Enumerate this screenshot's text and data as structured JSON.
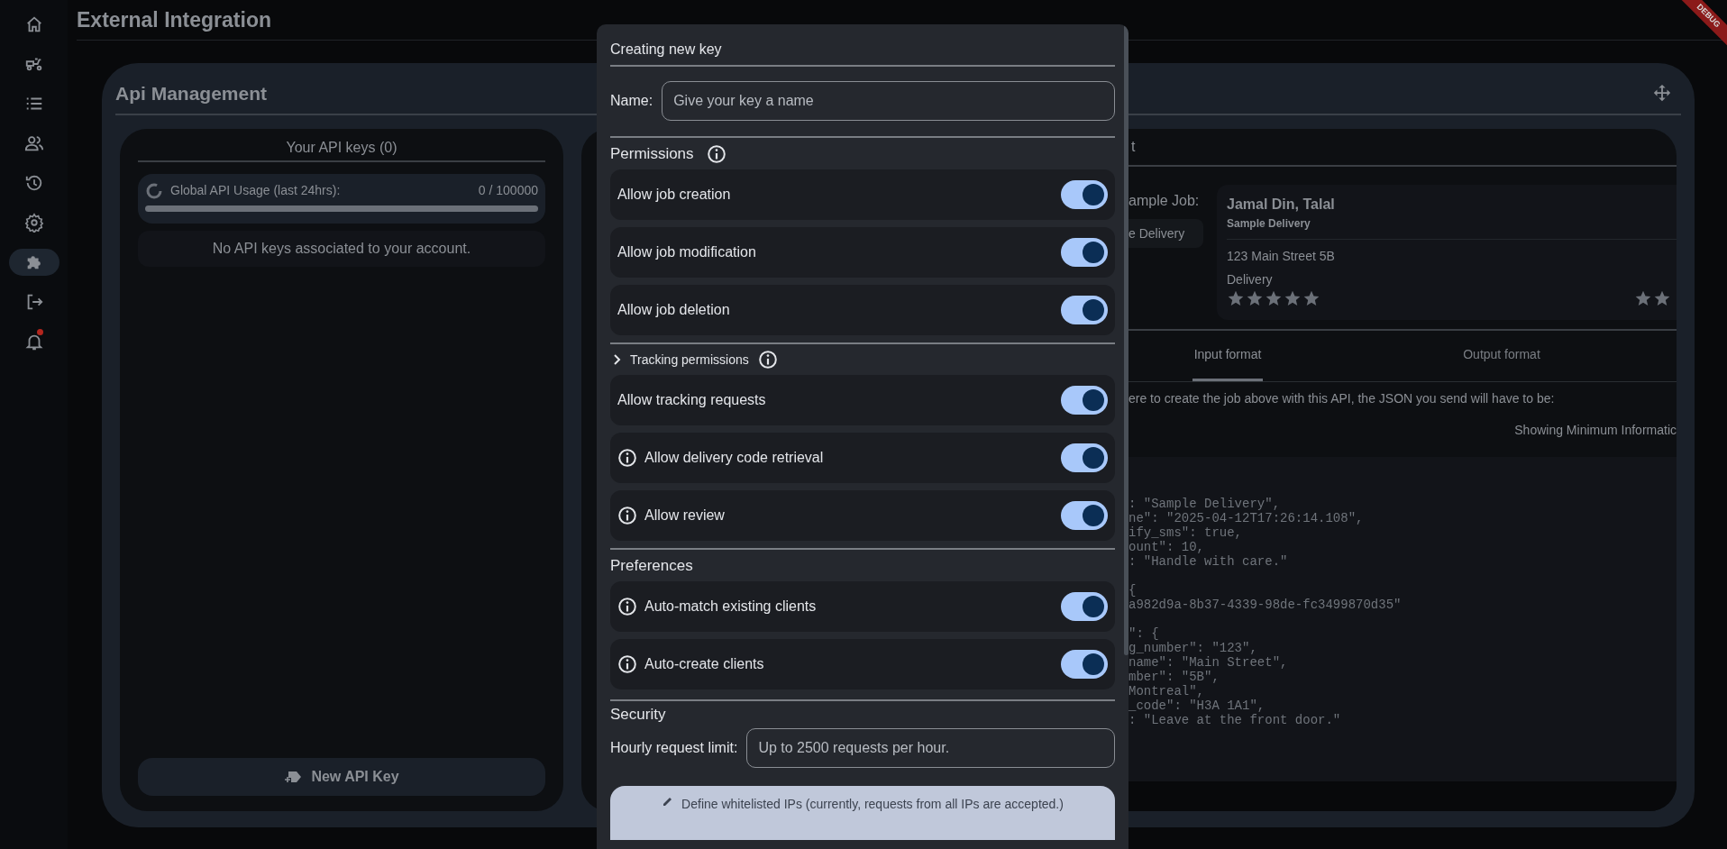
{
  "sidebar": {
    "items": [
      {
        "kind": "home",
        "selected": false,
        "notification": false
      },
      {
        "kind": "scooter",
        "selected": false,
        "notification": false
      },
      {
        "kind": "list",
        "selected": false,
        "notification": false
      },
      {
        "kind": "people",
        "selected": false,
        "notification": false
      },
      {
        "kind": "history",
        "selected": false,
        "notification": false
      },
      {
        "kind": "settings",
        "selected": false,
        "notification": false
      },
      {
        "kind": "puzzle",
        "selected": true,
        "notification": false
      },
      {
        "kind": "logout",
        "selected": false,
        "notification": false
      },
      {
        "kind": "bell",
        "selected": false,
        "notification": true
      }
    ]
  },
  "page_title": "External Integration",
  "debug_banner": "DEBUG",
  "api_management": {
    "title": "Api Management",
    "keys_panel": {
      "title": "Your API keys (0)",
      "usage": {
        "label": "Global API Usage (last 24hrs):",
        "value": "0 / 100000",
        "level": 0
      },
      "empty_message": "No API keys associated to your account.",
      "new_key_button": "New API Key"
    },
    "sample_panel": {
      "header_fragment": "t",
      "sample_job_label": "ample Job:",
      "job_chip": "e Delivery",
      "job_card": {
        "name": "Jamal Din, Talal",
        "type": "Sample Delivery",
        "address": "123 Main Street 5B",
        "category": "Delivery",
        "stars": 5
      },
      "tabs": [
        {
          "label": "Input format",
          "selected": true
        },
        {
          "label": "Output format",
          "selected": false
        }
      ],
      "description": "ere to create the job above with this API, the JSON you send will have to be:",
      "detail_level": "Showing Minimum Informatic",
      "code": ": \"Sample Delivery\",\nne\": \"2025-04-12T17:26:14.108\",\nify_sms\": true,\nount\": 10,\n: \"Handle with care.\"\n\n{\na982d9a-8b37-4339-98de-fc3499870d35\"\n\n\": {\ng_number\": \"123\",\nname\": \"Main Street\",\nmber\": \"5B\",\nMontreal\",\n_code\": \"H3A 1A1\",\n: \"Leave at the front door.\""
    }
  },
  "dialog": {
    "title": "Creating new key",
    "name_field": {
      "label": "Name:",
      "placeholder": "Give your key a name"
    },
    "sections": [
      {
        "title": "Permissions",
        "kind": "header",
        "info": true,
        "rows": [
          {
            "label": "Allow job creation",
            "info": false,
            "on": true
          },
          {
            "label": "Allow job modification",
            "info": false,
            "on": true
          },
          {
            "label": "Allow job deletion",
            "info": false,
            "on": true
          }
        ]
      },
      {
        "title": "Tracking permissions",
        "kind": "expander",
        "expanded": false,
        "info": true,
        "rows": [
          {
            "label": "Allow tracking requests",
            "info": false,
            "on": true
          },
          {
            "label": "Allow delivery code retrieval",
            "info": true,
            "on": true
          },
          {
            "label": "Allow review",
            "info": true,
            "on": true
          }
        ]
      },
      {
        "title": "Preferences",
        "kind": "header",
        "info": false,
        "rows": [
          {
            "label": "Auto-match existing clients",
            "info": true,
            "on": true
          },
          {
            "label": "Auto-create clients",
            "info": true,
            "on": true
          }
        ]
      }
    ],
    "security": {
      "title": "Security",
      "limit_label": "Hourly request limit:",
      "limit_placeholder": "Up to 2500 requests per hour.",
      "whitelist_button": "Define whitelisted IPs (currently, requests from all IPs are accepted.)"
    }
  }
}
